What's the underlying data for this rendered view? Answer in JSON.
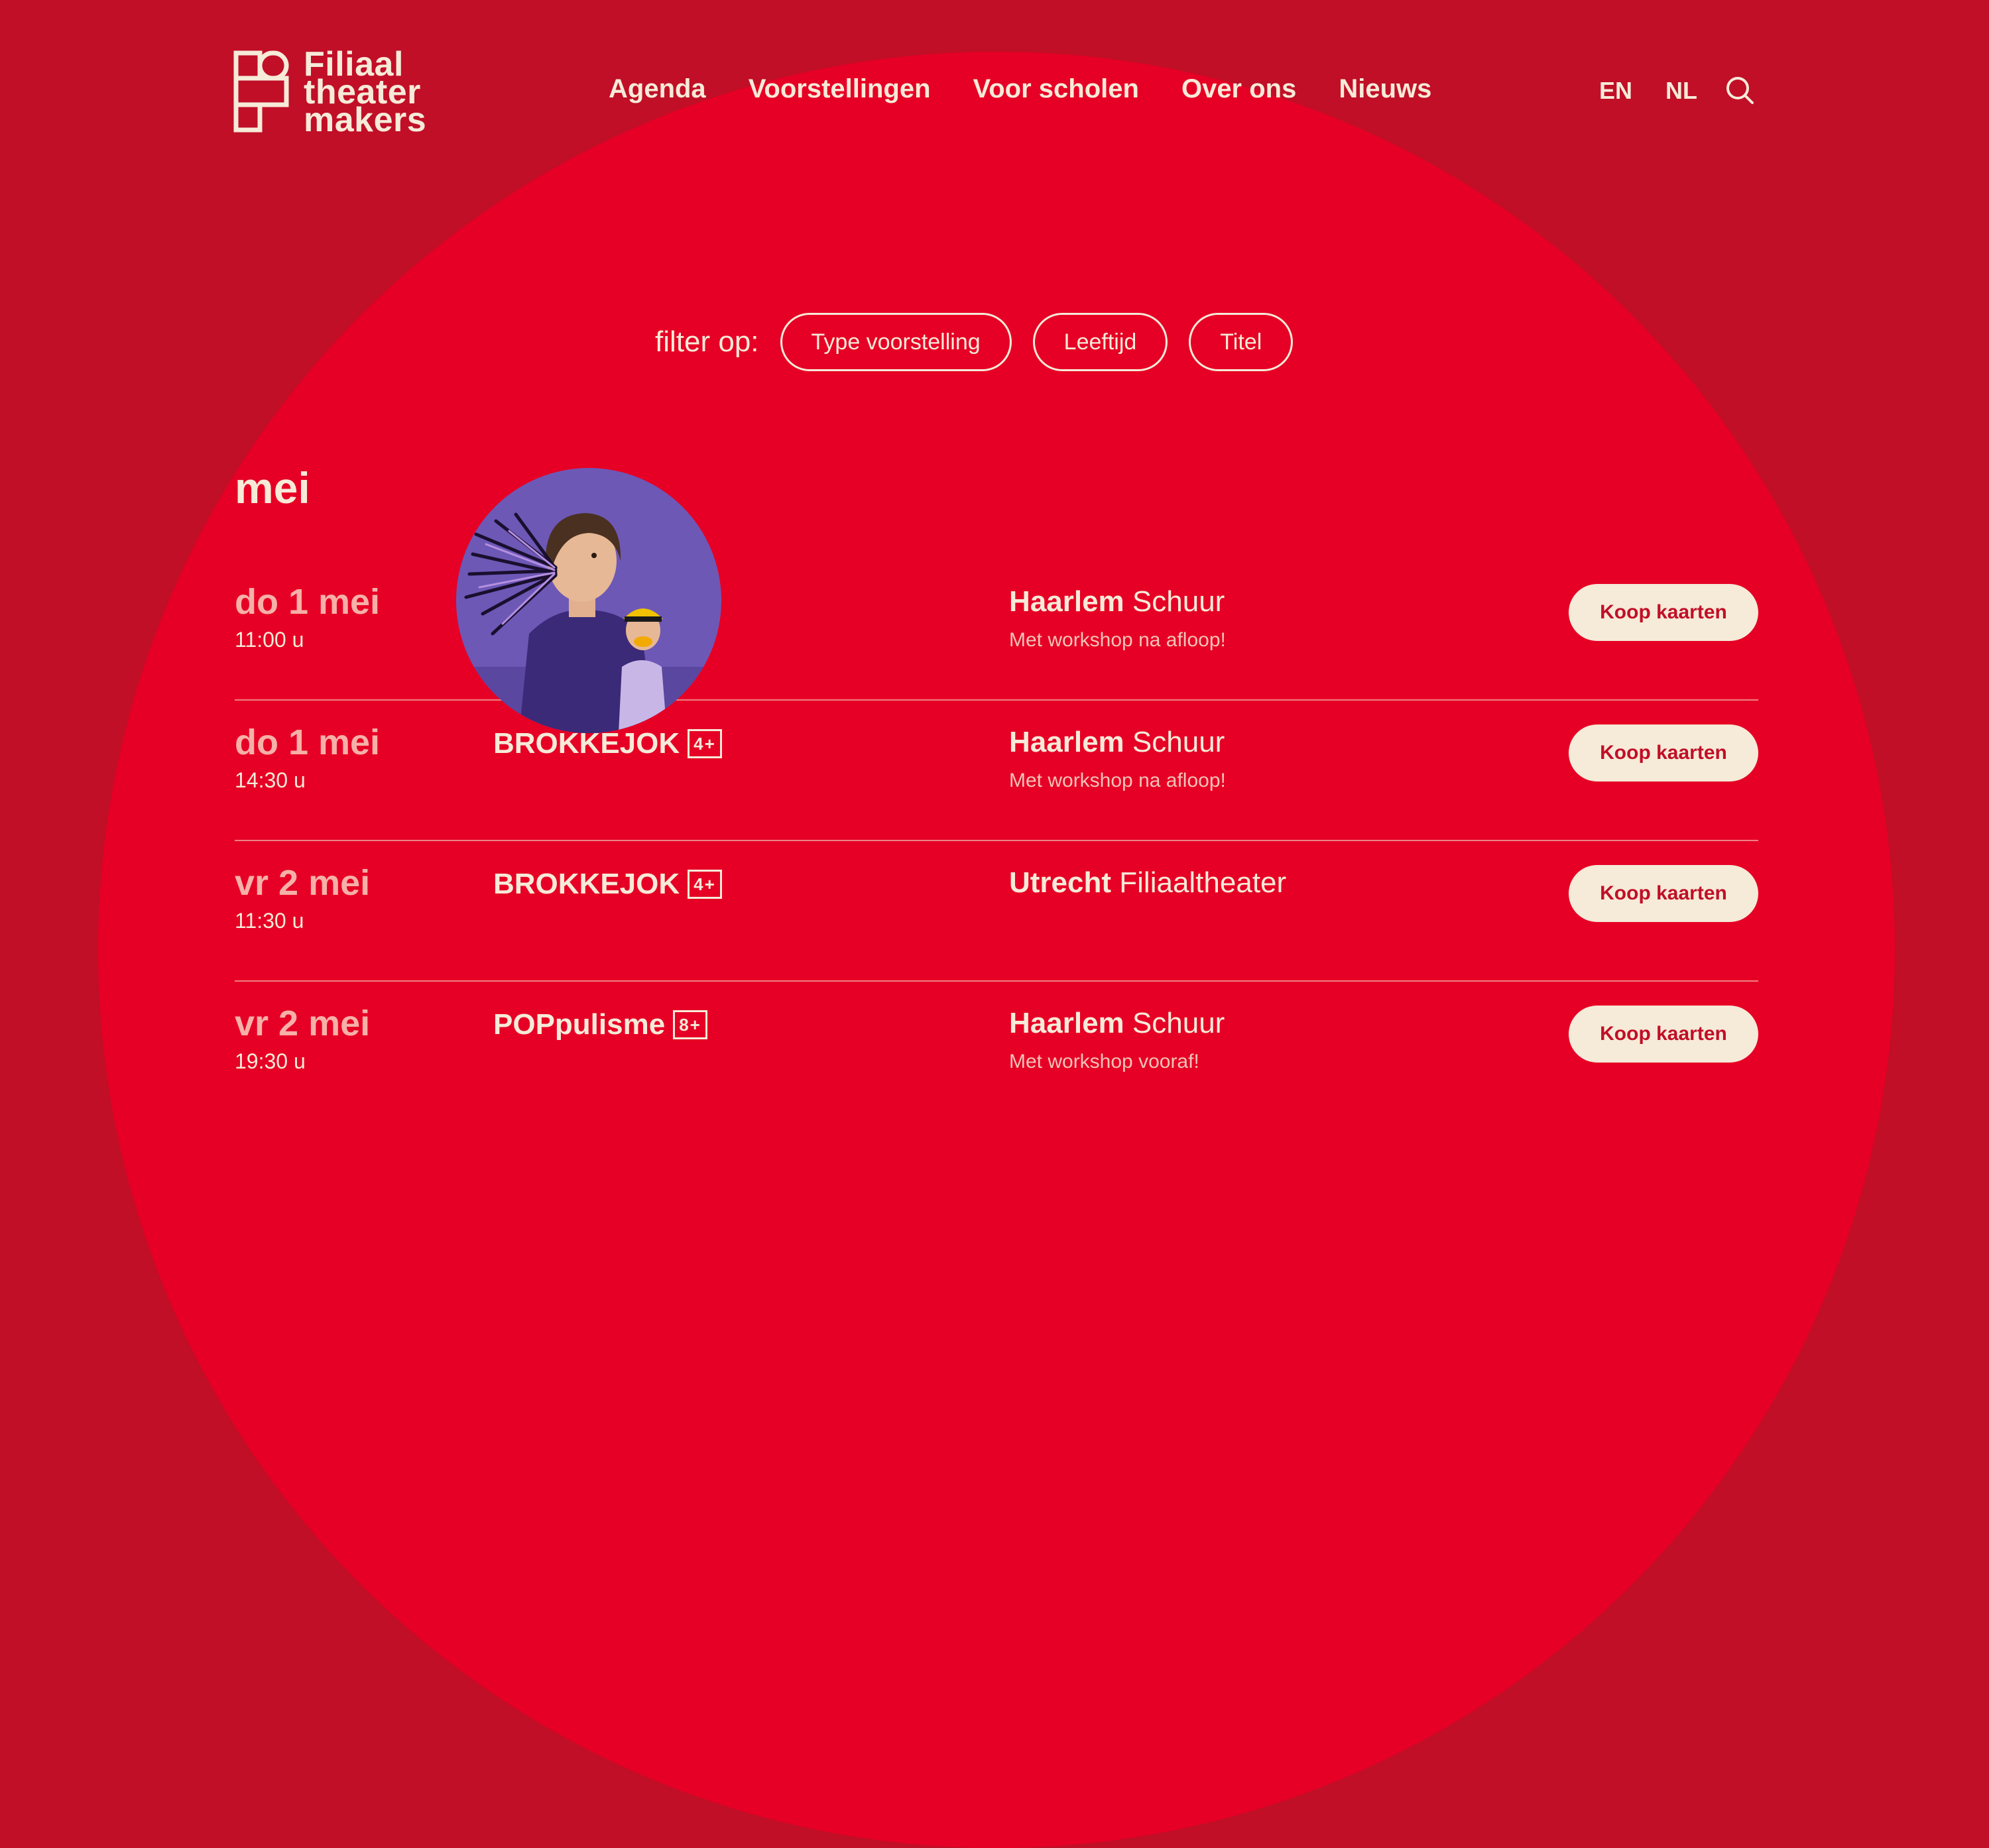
{
  "brand": {
    "name_lines": [
      "Filiaal",
      "theater",
      "makers"
    ]
  },
  "nav": {
    "items": [
      "Agenda",
      "Voorstellingen",
      "Voor scholen",
      "Over ons",
      "Nieuws"
    ]
  },
  "lang": {
    "en": "EN",
    "nl": "NL"
  },
  "filter": {
    "label": "filter op:",
    "options": [
      "Type voorstelling",
      "Leeftijd",
      "Titel"
    ]
  },
  "month": "mei",
  "events": [
    {
      "date": "do 1 mei",
      "time": "11:00 u",
      "title": "",
      "age": "",
      "city": "Haarlem",
      "venue": "Schuur",
      "note": "Met workshop na afloop!",
      "button": "Koop kaarten"
    },
    {
      "date": "do 1 mei",
      "time": "14:30 u",
      "title": "BROKKEJOK",
      "age": "4+",
      "city": "Haarlem",
      "venue": "Schuur",
      "note": "Met workshop na afloop!",
      "button": "Koop kaarten"
    },
    {
      "date": "vr 2 mei",
      "time": "11:30 u",
      "title": "BROKKEJOK",
      "age": "4+",
      "city": "Utrecht",
      "venue": "Filiaaltheater",
      "note": "",
      "button": "Koop kaarten"
    },
    {
      "date": "vr 2 mei",
      "time": "19:30 u",
      "title": "POPpulisme",
      "age": "8+",
      "city": "Haarlem",
      "venue": "Schuur",
      "note": "Met workshop vooraf!",
      "button": "Koop kaarten"
    }
  ],
  "colors": {
    "background": "#c00f27",
    "circle": "#e60025",
    "cream": "#f6ead8"
  },
  "icons": {
    "search": "search-icon",
    "logo": "logo-mark-icon"
  }
}
